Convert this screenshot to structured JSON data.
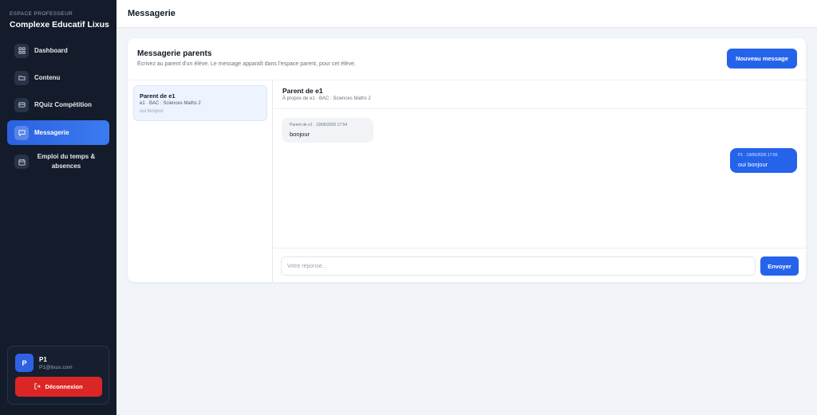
{
  "sidebar": {
    "brand_small": "ESPACE PROFESSEUR",
    "brand_name": "Complexe Educatif Lixus",
    "items": [
      {
        "label": "Dashboard",
        "icon": "grid-icon"
      },
      {
        "label": "Contenu",
        "icon": "folder-icon"
      },
      {
        "label": "RQuiz Compétition",
        "icon": "quiz-icon"
      },
      {
        "label": "Messagerie",
        "icon": "message-icon",
        "active": true
      },
      {
        "label": "Emploi du temps & absences",
        "icon": "calendar-icon"
      }
    ],
    "user": {
      "initial": "P",
      "name": "P1",
      "email": "P1@lixus.com",
      "logout_label": "Déconnexion"
    }
  },
  "topbar": {
    "title": "Messagerie"
  },
  "messaging": {
    "title": "Messagerie parents",
    "subtitle": "Écrivez au parent d'un élève. Le message apparaît dans l'espace parent, pour cet élève.",
    "new_message_label": "Nouveau message",
    "conversations": [
      {
        "name": "Parent de e1",
        "meta": "e1 · BAC : Sciences Maths 2",
        "preview": "oui bonjour"
      }
    ],
    "thread": {
      "title": "Parent de e1",
      "subtitle": "À propos de e1 · BAC : Sciences Maths 2",
      "messages": [
        {
          "direction": "in",
          "meta": "Parent de e1 · 19/06/2026 17:54",
          "text": "bonjour"
        },
        {
          "direction": "out",
          "meta": "P1 · 19/06/2026 17:56",
          "text": "oui bonjour"
        }
      ]
    },
    "composer": {
      "placeholder": "Votre réponse...",
      "value": "",
      "send_label": "Envoyer"
    }
  },
  "colors": {
    "sidebar_bg": "#141c2b",
    "accent": "#2563eb",
    "danger": "#dc2626",
    "page_bg": "#f1f4f8"
  }
}
